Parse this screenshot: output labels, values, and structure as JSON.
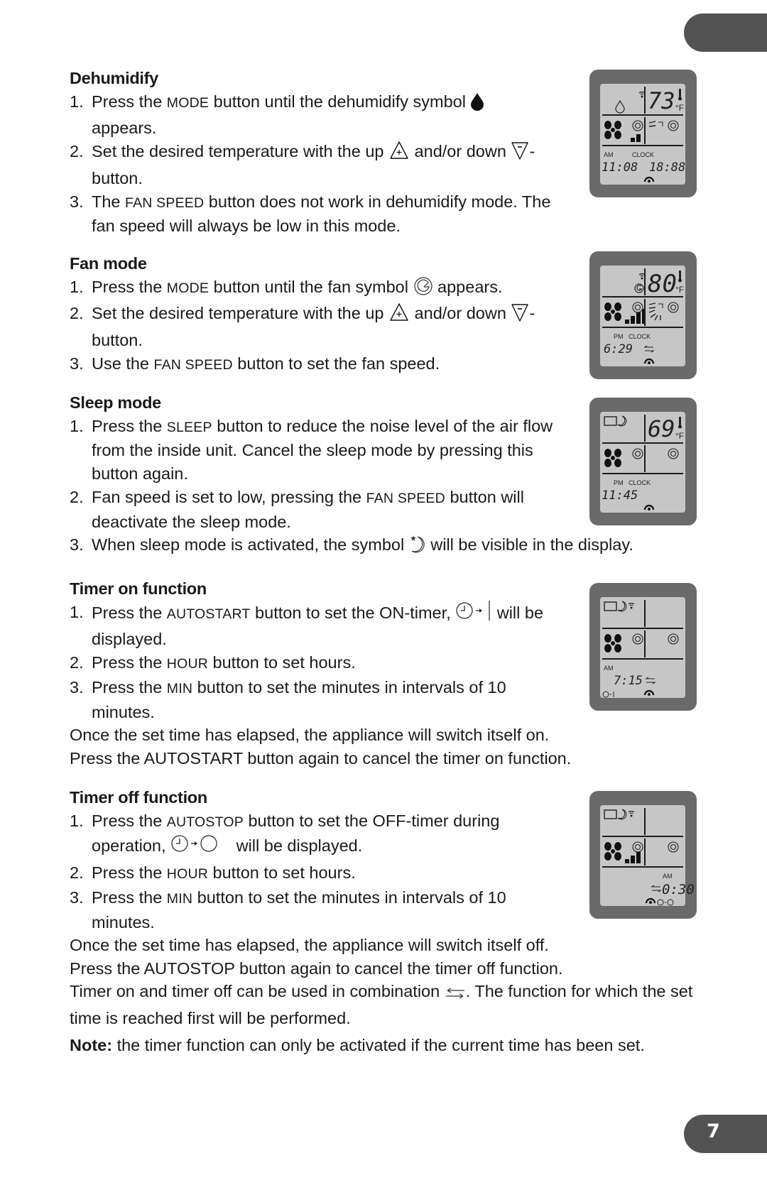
{
  "page_number": "7",
  "sections": [
    {
      "id": "dehumidify",
      "heading": "Dehumidify",
      "items": [
        {
          "num": "1.",
          "parts": [
            "Press the ",
            "MODE",
            " button until the dehumidify symbol ",
            "[drop-icon]",
            " appears."
          ]
        },
        {
          "num": "2.",
          "parts": [
            "Set the desired temperature with the up ",
            "[up-button-icon]",
            " and/or down ",
            "[down-button-icon]",
            "-button."
          ]
        },
        {
          "num": "3.",
          "parts": [
            "The ",
            "FAN SPEED",
            " button does not work in dehumidify mode. The fan speed will always be low in this mode."
          ]
        }
      ],
      "display": {
        "mode_icon": "drop",
        "temperature": "73",
        "unit": "°F",
        "fan_bars": 2,
        "am_pm": "AM",
        "clock_label": "CLOCK",
        "time_left": "11:08",
        "time_right": "18:88"
      }
    },
    {
      "id": "fan-mode",
      "heading": "Fan mode",
      "items": [
        {
          "num": "1.",
          "parts": [
            "Press the ",
            "MODE",
            " button until the fan symbol ",
            "[fan-symbol-icon]",
            " appears."
          ]
        },
        {
          "num": "2.",
          "parts": [
            "Set the desired temperature with the up ",
            "[up-button-icon]",
            " and/or down ",
            "[down-button-icon]",
            "-button."
          ]
        },
        {
          "num": "3.",
          "parts": [
            "Use the ",
            "FAN SPEED",
            " button to set the fan speed."
          ]
        }
      ],
      "display": {
        "mode_icon": "fan",
        "temperature": "80",
        "unit": "°F",
        "fan_bars": 4,
        "am_pm": "PM",
        "clock_label": "CLOCK",
        "time_left": "6:29"
      }
    },
    {
      "id": "sleep-mode",
      "heading": "Sleep mode",
      "items": [
        {
          "num": "1.",
          "parts": [
            "Press the ",
            "SLEEP",
            " button to reduce the noise level of the air flow from the inside unit. Cancel the sleep mode by pressing this button again."
          ]
        },
        {
          "num": "2.",
          "parts": [
            "Fan speed is set to low, pressing the ",
            "FAN SPEED",
            " button will deactivate the sleep mode."
          ]
        },
        {
          "num": "3.",
          "parts": [
            "When sleep mode is activated, the symbol ",
            "[sleep-moon-icon]",
            " will be visible in the display."
          ]
        }
      ],
      "display": {
        "temperature": "69",
        "unit": "°F",
        "am_pm": "PM",
        "clock_label": "CLOCK",
        "time_left": "11:45"
      }
    },
    {
      "id": "timer-on",
      "heading": "Timer on function",
      "items": [
        {
          "num": "1.",
          "parts": [
            "Press the ",
            "AUTOSTART",
            " button to set the ON-timer, ",
            "[timer-on-icon]",
            " will be displayed."
          ]
        },
        {
          "num": "2.",
          "parts": [
            "Press the ",
            "HOUR",
            " button to set hours."
          ]
        },
        {
          "num": "3.",
          "parts": [
            "Press the ",
            "MIN",
            " button to set the minutes in intervals of 10 minutes."
          ]
        }
      ],
      "after": [
        "Once the set time has elapsed, the appliance will switch itself on.",
        "Press the AUTOSTART button again to cancel the timer on function."
      ],
      "display": {
        "am_pm": "AM",
        "time_left": "7:15"
      }
    },
    {
      "id": "timer-off",
      "heading": "Timer off function",
      "items": [
        {
          "num": "1.",
          "parts": [
            "Press the ",
            "AUTOSTOP",
            " button to set the OFF-timer during operation, ",
            "[timer-off-icon]",
            " will be displayed."
          ]
        },
        {
          "num": "2.",
          "parts": [
            "Press the ",
            "HOUR",
            " button to set hours."
          ]
        },
        {
          "num": "3.",
          "parts": [
            "Press the ",
            "MIN",
            " button to set the minutes in intervals of 10 minutes."
          ]
        }
      ],
      "after": [
        "Once the set time has elapsed, the appliance will switch itself off.",
        "Press the AUTOSTOP button again to cancel the timer off function."
      ],
      "display": {
        "am_pm": "AM",
        "time_right": "0:30"
      }
    }
  ],
  "combination": {
    "text_before": "Timer on and timer off can be used in combination ",
    "icon": "combination-arrows-icon",
    "text_after": ". The function for which the set time is reached first will be performed."
  },
  "note": {
    "label": "Note:",
    "text": " the timer function can only be activated if the current time has been set."
  },
  "colors": {
    "tab": "#535353",
    "lcd_frame": "#6a6a6a",
    "lcd_screen": "#c6c6c6",
    "lcd_ink": "#1c1c1c"
  }
}
